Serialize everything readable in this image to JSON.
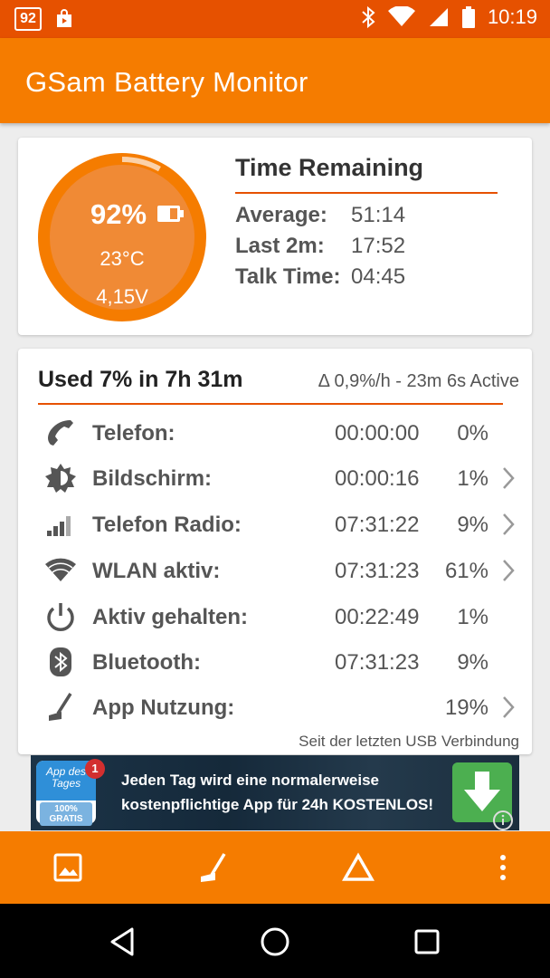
{
  "status_bar": {
    "notification_badge": "92",
    "time": "10:19",
    "icons": [
      "notification-badge-icon",
      "shopping-bag-icon",
      "bluetooth-icon",
      "wifi-icon",
      "signal-icon",
      "battery-icon"
    ]
  },
  "toolbar": {
    "title": "GSam Battery Monitor"
  },
  "gauge": {
    "percent_label": "92%",
    "level_fraction": 0.92,
    "temperature": "23°C",
    "voltage": "4,15V"
  },
  "time_remaining": {
    "title": "Time Remaining",
    "rows": [
      {
        "label": "Average:",
        "value": "51:14"
      },
      {
        "label": "Last 2m:",
        "value": "17:52"
      },
      {
        "label": "Talk Time:",
        "value": "04:45"
      }
    ]
  },
  "usage": {
    "title": "Used 7% in 7h 31m",
    "rate": "Δ 0,9%/h - 23m 6s Active",
    "rows": [
      {
        "icon": "phone-icon",
        "label": "Telefon:",
        "time": "00:00:00",
        "percent": "0%",
        "chevron": false
      },
      {
        "icon": "brightness-icon",
        "label": "Bildschirm:",
        "time": "00:00:16",
        "percent": "1%",
        "chevron": true
      },
      {
        "icon": "signal-bars-icon",
        "label": "Telefon Radio:",
        "time": "07:31:22",
        "percent": "9%",
        "chevron": true
      },
      {
        "icon": "wifi-icon",
        "label": "WLAN aktiv:",
        "time": "07:31:23",
        "percent": "61%",
        "chevron": true
      },
      {
        "icon": "power-icon",
        "label": "Aktiv gehalten:",
        "time": "00:22:49",
        "percent": "1%",
        "chevron": false
      },
      {
        "icon": "bluetooth-icon",
        "label": "Bluetooth:",
        "time": "07:31:23",
        "percent": "9%",
        "chevron": false
      },
      {
        "icon": "broom-icon",
        "label": "App Nutzung:",
        "time": "",
        "percent": "19%",
        "chevron": true
      }
    ],
    "footer_note": "Seit der letzten USB Verbindung"
  },
  "ad": {
    "logo_text": "App des Tages",
    "logo_sub": "100% GRATIS",
    "badge_count": "1",
    "line1": "Jeden Tag wird eine normalerweise",
    "line2": "kostenpflichtige App für 24h KOSTENLOS!"
  },
  "bottom_bar": {
    "buttons": [
      "image-icon",
      "broom-icon",
      "delta-icon",
      "overflow-menu-icon"
    ]
  },
  "colors": {
    "status_bar": "#e65100",
    "toolbar": "#f57c00",
    "accent_line": "#e65100",
    "gauge_outer": "#f57c00",
    "gauge_inner": "#f08a35"
  }
}
